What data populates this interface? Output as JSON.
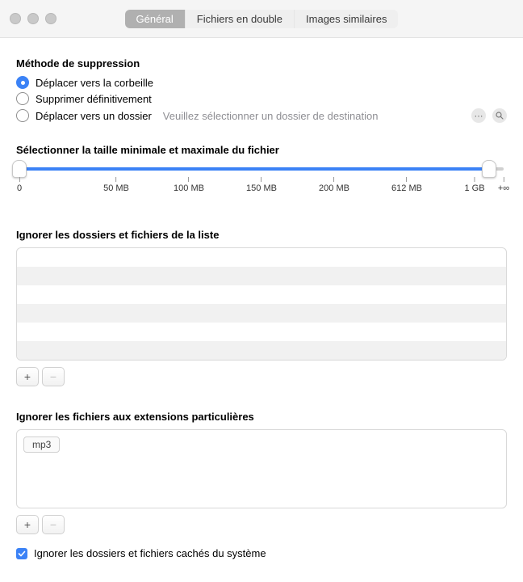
{
  "tabs": [
    "Général",
    "Fichiers en double",
    "Images similaires"
  ],
  "active_tab": 0,
  "deletion": {
    "title": "Méthode de suppression",
    "options": [
      "Déplacer vers la corbeille",
      "Supprimer définitivement",
      "Déplacer vers un dossier"
    ],
    "selected": 0,
    "folder_placeholder": "Veuillez sélectionner un dossier de destination"
  },
  "size": {
    "title": "Sélectionner la taille minimale et maximale du fichier",
    "ticks": [
      {
        "label": "0",
        "pos": 0
      },
      {
        "label": "50 MB",
        "pos": 20
      },
      {
        "label": "100 MB",
        "pos": 35
      },
      {
        "label": "150 MB",
        "pos": 50
      },
      {
        "label": "200 MB",
        "pos": 65
      },
      {
        "label": "612 MB",
        "pos": 80
      },
      {
        "label": "1 GB",
        "pos": 94
      },
      {
        "label": "+∞",
        "pos": 100
      }
    ],
    "range_min_pct": 0,
    "range_max_pct": 97
  },
  "ignore_folders": {
    "title": "Ignorer les dossiers et fichiers de la liste",
    "items": []
  },
  "ignore_ext": {
    "title": "Ignorer les fichiers aux extensions particulières",
    "tags": [
      "mp3"
    ]
  },
  "buttons": {
    "add": "+",
    "remove": "−"
  },
  "hidden_checkbox": {
    "label": "Ignorer les dossiers et fichiers cachés du système",
    "checked": true
  }
}
